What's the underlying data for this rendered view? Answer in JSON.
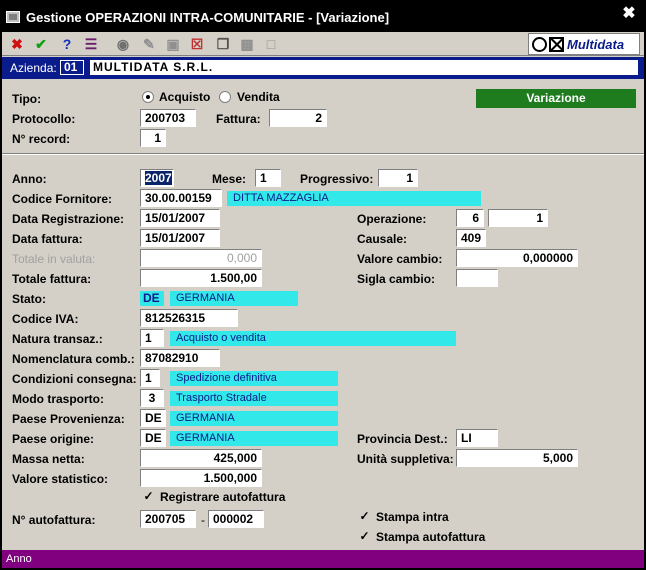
{
  "window": {
    "title": "Gestione OPERAZIONI INTRA-COMUNITARIE - [Variazione]"
  },
  "toolbar": {
    "icons": [
      "close-icon",
      "check-icon",
      "help-icon",
      "book-icon",
      "binoculars-icon",
      "edit-icon",
      "copy-record-icon",
      "delete-icon",
      "clipboard-icon",
      "paste-icon",
      "new-page-icon"
    ],
    "brand": "Multidata"
  },
  "azienda": {
    "label": "Azienda:",
    "code": "01",
    "name": "MULTIDATA S.R.L."
  },
  "header": {
    "tipo_label": "Tipo:",
    "acquisto": "Acquisto",
    "vendita": "Vendita",
    "protocollo_label": "Protocollo:",
    "protocollo": "200703",
    "fattura_label": "Fattura:",
    "fattura": "2",
    "record_label": "N° record:",
    "record": "1",
    "status_button": "Variazione"
  },
  "form": {
    "anno_label": "Anno:",
    "anno": "2007",
    "mese_label": "Mese:",
    "mese": "1",
    "progressivo_label": "Progressivo:",
    "progressivo": "1",
    "fornitore_label": "Codice Fornitore:",
    "fornitore": "30.00.00159",
    "fornitore_desc": "DITTA MAZZAGLIA",
    "data_reg_label": "Data Registrazione:",
    "data_reg": "15/01/2007",
    "operazione_label": "Operazione:",
    "operazione1": "6",
    "operazione2": "1",
    "data_fatt_label": "Data fattura:",
    "data_fatt": "15/01/2007",
    "causale_label": "Causale:",
    "causale": "409",
    "tot_valuta_label": "Totale in valuta:",
    "tot_valuta": "0,000",
    "valore_cambio_label": "Valore cambio:",
    "valore_cambio": "0,000000",
    "tot_fattura_label": "Totale fattura:",
    "tot_fattura": "1.500,00",
    "sigla_cambio_label": "Sigla cambio:",
    "sigla_cambio": "",
    "stato_label": "Stato:",
    "stato": "DE",
    "stato_desc": "GERMANIA",
    "iva_label": "Codice IVA:",
    "iva": "812526315",
    "natura_label": "Natura transaz.:",
    "natura": "1",
    "natura_desc": "Acquisto o vendita",
    "nomenclatura_label": "Nomenclatura comb.:",
    "nomenclatura": "87082910",
    "condizioni_label": "Condizioni consegna:",
    "condizioni": "1",
    "condizioni_desc": "Spedizione definitiva",
    "modo_label": "Modo trasporto:",
    "modo": "3",
    "modo_desc": "Trasporto Stradale",
    "provenienza_label": "Paese Provenienza:",
    "provenienza": "DE",
    "provenienza_desc": "GERMANIA",
    "origine_label": "Paese origine:",
    "origine": "DE",
    "origine_desc": "GERMANIA",
    "provincia_label": "Provincia Dest.:",
    "provincia": "LI",
    "massa_label": "Massa netta:",
    "massa": "425,000",
    "unita_label": "Unità suppletiva:",
    "unita": "5,000",
    "statistico_label": "Valore statistico:",
    "statistico": "1.500,000",
    "registrare_label": "Registrare autofattura",
    "autofatt_label": "N° autofattura:",
    "autofatt1": "200705",
    "autofatt_sep": "-",
    "autofatt2": "000002",
    "stampa_intra_label": "Stampa intra",
    "stampa_auto_label": "Stampa autofattura"
  },
  "statusbar": {
    "text": "Anno"
  }
}
